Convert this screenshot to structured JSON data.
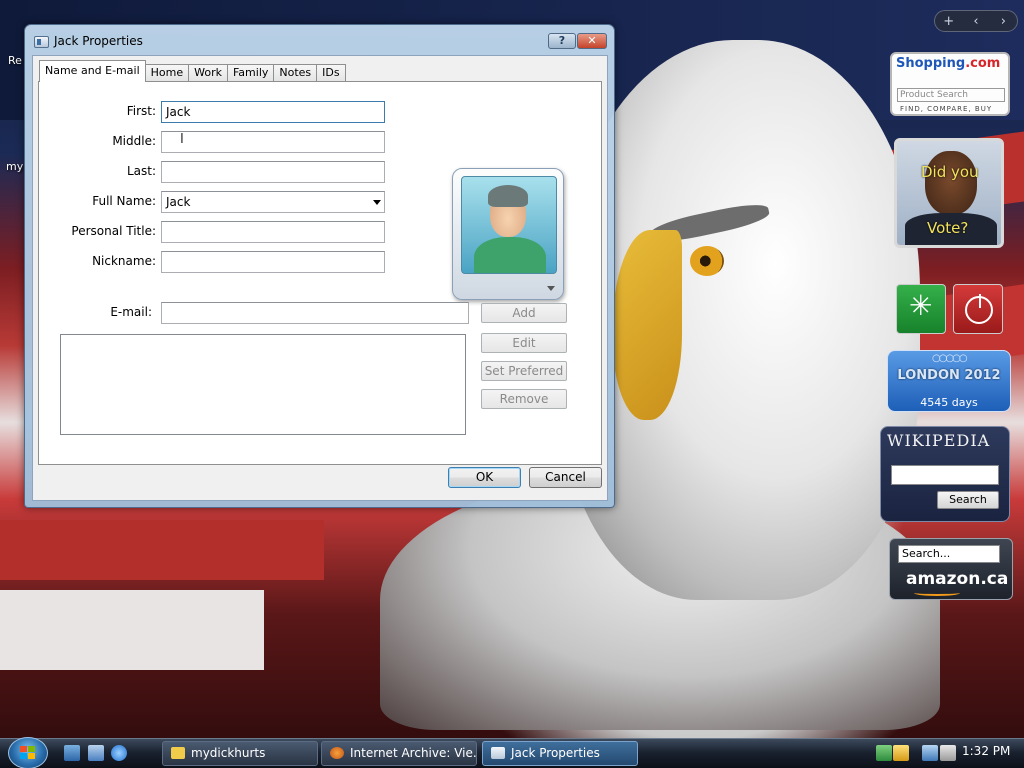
{
  "desktop": {
    "icon_label_1": "Re",
    "icon_label_2": "my"
  },
  "window": {
    "title": "Jack Properties",
    "help_btn": "?",
    "close_btn": "✕",
    "tabs": [
      "Name and E-mail",
      "Home",
      "Work",
      "Family",
      "Notes",
      "IDs"
    ],
    "active_tab": "Name and E-mail",
    "fields": {
      "first_label": "First:",
      "first_value": "Jack",
      "middle_label": "Middle:",
      "middle_value": "",
      "last_label": "Last:",
      "last_value": "",
      "fullname_label": "Full Name:",
      "fullname_value": "Jack",
      "title_label": "Personal Title:",
      "title_value": "",
      "nickname_label": "Nickname:",
      "nickname_value": "",
      "email_label": "E-mail:",
      "email_value": ""
    },
    "email_buttons": {
      "add": "Add",
      "edit": "Edit",
      "set_preferred": "Set Preferred",
      "remove": "Remove"
    },
    "ok": "OK",
    "cancel": "Cancel"
  },
  "sidebar": {
    "controls": [
      "+",
      "‹",
      "›"
    ],
    "shopping": {
      "logo_text": "Shopping",
      "logo_suffix": ".com",
      "placeholder": "Product Search",
      "tagline": "FIND, COMPARE, BUY"
    },
    "obama": {
      "line1": "Did you",
      "line2": "Vote?"
    },
    "london": {
      "title": "LONDON 2012",
      "days": "4545 days"
    },
    "wikipedia": {
      "title": "WIKIPEDIA",
      "search_btn": "Search"
    },
    "amazon": {
      "placeholder": "Search...",
      "logo": "amazon.ca"
    }
  },
  "taskbar": {
    "items": [
      {
        "label": "mydickhurts",
        "icon": "folder-icon"
      },
      {
        "label": "Internet Archive: Vie...",
        "icon": "firefox-icon"
      },
      {
        "label": "Jack Properties",
        "icon": "contact-icon"
      }
    ],
    "clock": "1:32 PM"
  },
  "colors": {
    "accent": "#3c7fb1",
    "taskbar": "#1a2230"
  }
}
